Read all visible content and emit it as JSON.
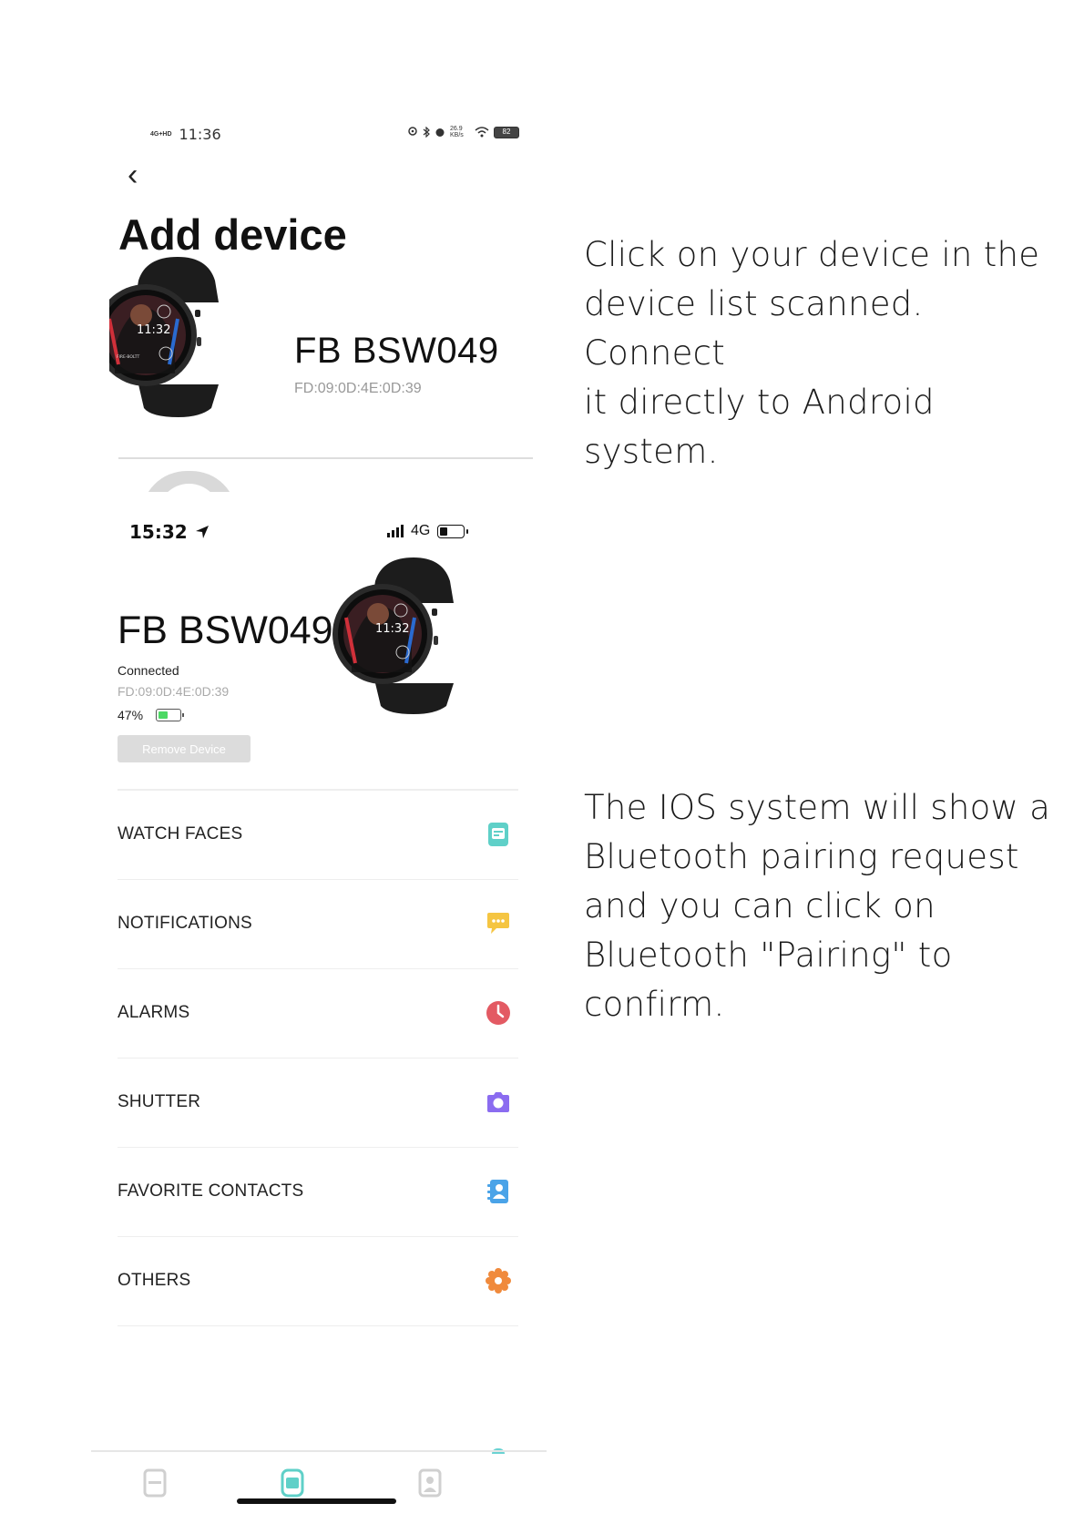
{
  "colors": {
    "accent_teal": "#5fd0c8",
    "battery_green": "#4cd964",
    "alarm_red": "#e35a63",
    "notif_yellow": "#f5c542",
    "shutter_purple": "#8b6cf0",
    "contacts_blue": "#4aa3e8",
    "others_orange": "#f08a3c"
  },
  "screen1": {
    "status": {
      "signal": "4G+HD",
      "time": "11:36",
      "speed": "26.9 KB/s",
      "battery": "82"
    },
    "title": "Add device",
    "device": {
      "name": "FB BSW049",
      "mac": "FD:09:0D:4E:0D:39",
      "watch_time": "11:32",
      "watch_brand": "FIRE-BOLTT"
    }
  },
  "screen2": {
    "status": {
      "time": "15:32",
      "network": "4G"
    },
    "device": {
      "name": "FB BSW049",
      "status": "Connected",
      "mac": "FD:09:0D:4E:0D:39",
      "battery": "47%",
      "battery_fraction": 0.47,
      "watch_time": "11:32"
    },
    "remove_label": "Remove Device",
    "menu": [
      {
        "label": "WATCH FACES",
        "icon": "watch-face-icon"
      },
      {
        "label": "NOTIFICATIONS",
        "icon": "chat-bubble-icon"
      },
      {
        "label": "ALARMS",
        "icon": "clock-icon"
      },
      {
        "label": "SHUTTER",
        "icon": "camera-icon"
      },
      {
        "label": "FAVORITE CONTACTS",
        "icon": "contact-book-icon"
      },
      {
        "label": "OTHERS",
        "icon": "gear-icon"
      }
    ],
    "tabs": [
      "activity-tab-icon",
      "device-tab-icon",
      "profile-tab-icon"
    ]
  },
  "instructions": {
    "first": "Click on your device in the\ndevice list scanned. Connect\nit directly to Android system.",
    "second": "The IOS system will show a\nBluetooth pairing request\nand you can click on\nBluetooth \"Pairing\" to\nconfirm."
  }
}
